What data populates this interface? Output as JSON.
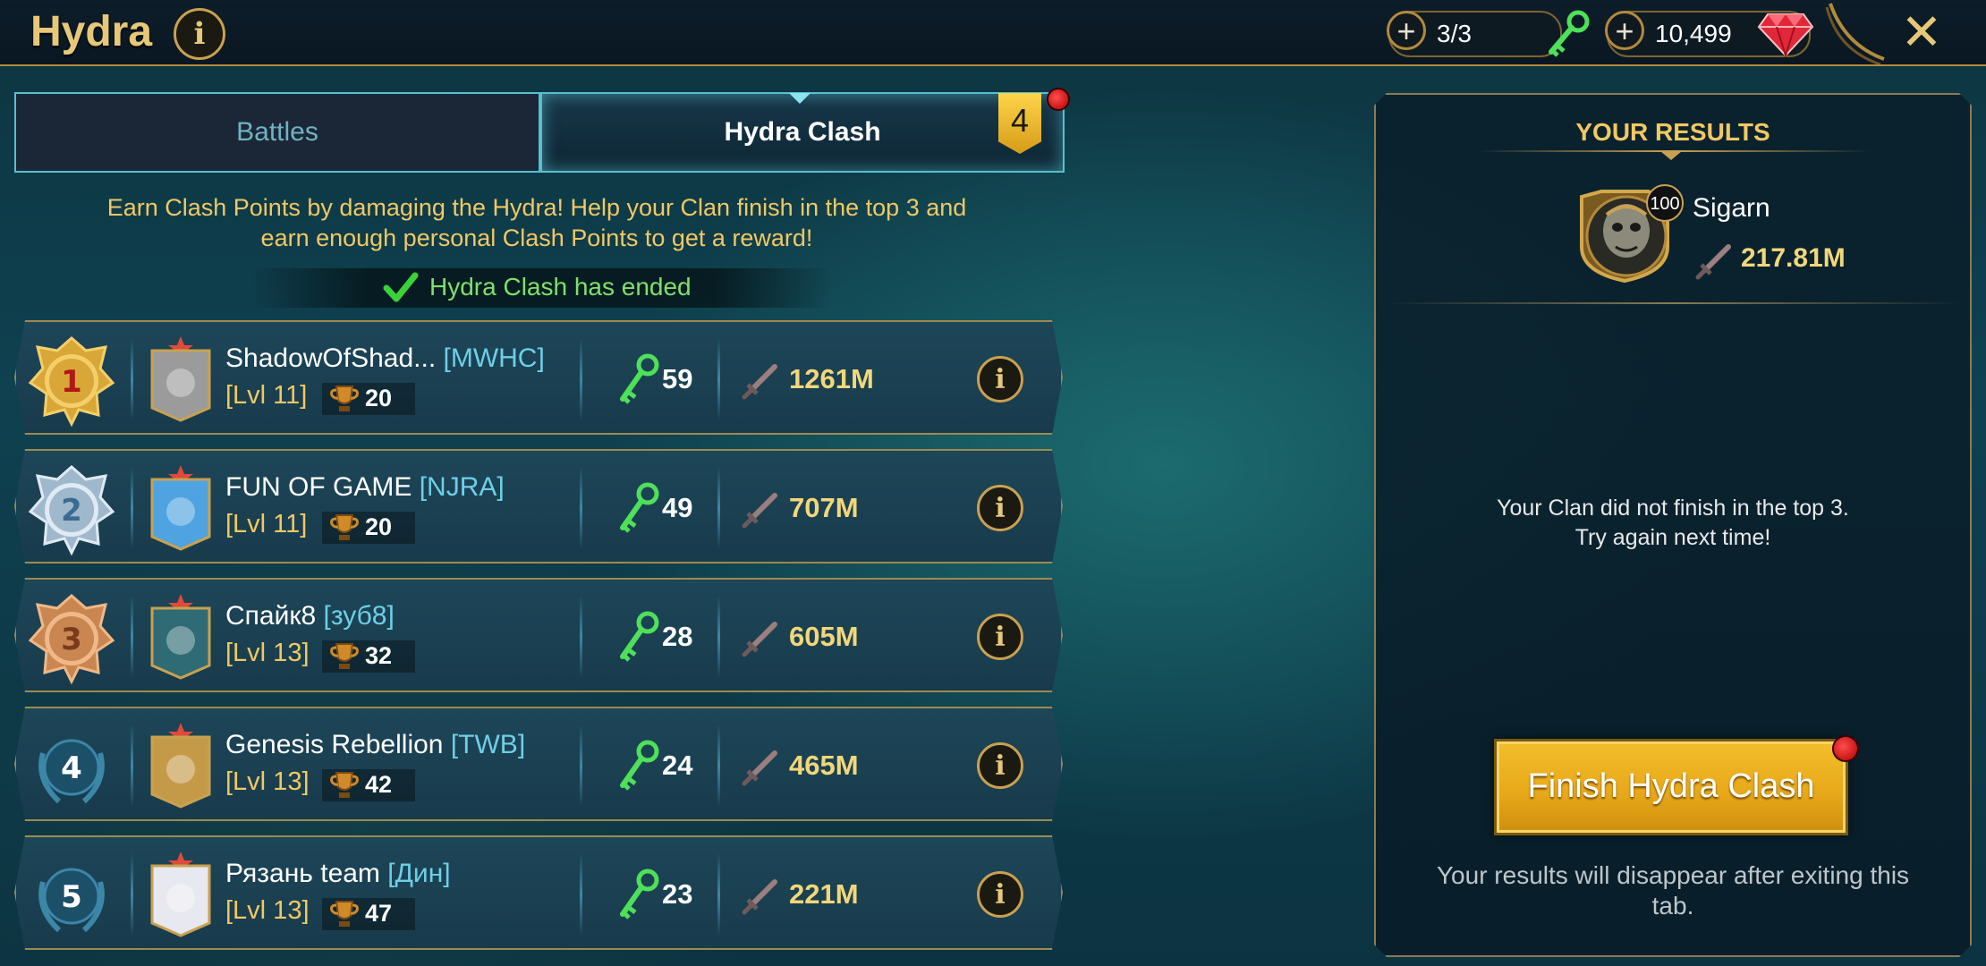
{
  "header": {
    "title": "Hydra",
    "info_icon": "info-icon",
    "keys": "3/3",
    "gems": "10,499",
    "close_icon": "close-icon"
  },
  "tabs": [
    {
      "label": "Battles",
      "active": false
    },
    {
      "label": "Hydra Clash",
      "active": true,
      "badge": "4"
    }
  ],
  "description": {
    "line1": "Earn Clash Points by damaging the Hydra! Help your Clan finish in the top 3 and",
    "line2": "earn enough personal Clash Points to get a reward!"
  },
  "status": "Hydra Clash has ended",
  "colors": {
    "accent_gold": "#f2c862",
    "tab_border": "#58bfd1",
    "success": "#7fe06a",
    "button_gold": "#e8a91a"
  },
  "rows": [
    {
      "rank": "1",
      "name": "ShadowOfShad...",
      "tag": "[MWHC]",
      "level": "[Lvl 11]",
      "trophies": "20",
      "keys": "59",
      "damage": "1261M"
    },
    {
      "rank": "2",
      "name": "FUN OF GAME",
      "tag": "[NJRA]",
      "level": "[Lvl 11]",
      "trophies": "20",
      "keys": "49",
      "damage": "707M"
    },
    {
      "rank": "3",
      "name": "Спайк8",
      "tag": "[зуб8]",
      "level": "[Lvl 13]",
      "trophies": "32",
      "keys": "28",
      "damage": "605M"
    },
    {
      "rank": "4",
      "name": "Genesis Rebellion",
      "tag": "[TWB]",
      "level": "[Lvl 13]",
      "trophies": "42",
      "keys": "24",
      "damage": "465M"
    },
    {
      "rank": "5",
      "name": "Рязань team",
      "tag": "[Дин]",
      "level": "[Lvl 13]",
      "trophies": "47",
      "keys": "23",
      "damage": "221M"
    }
  ],
  "results": {
    "title": "YOUR RESULTS",
    "player_level": "100",
    "player_name": "Sigarn",
    "player_damage": "217.81M",
    "clan_msg_line1": "Your Clan did not finish in the top 3.",
    "clan_msg_line2": "Try again next time!",
    "finish_button": "Finish Hydra Clash",
    "disappear_line1": "Your results will disappear after exiting this",
    "disappear_line2": "tab."
  }
}
